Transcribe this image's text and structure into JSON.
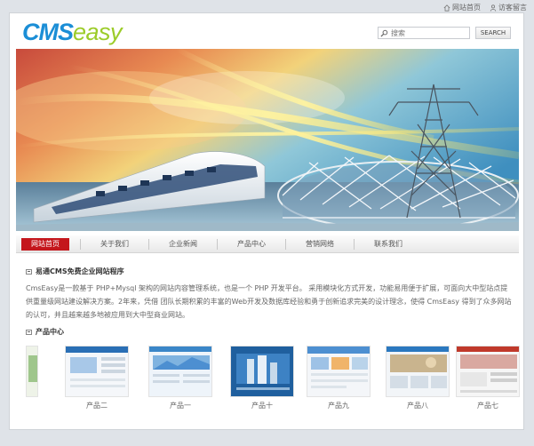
{
  "topbar": {
    "home": "网站首页",
    "guestbook": "访客留言"
  },
  "logo": {
    "part1": "CMS",
    "part2": "easy"
  },
  "search": {
    "placeholder": "搜索",
    "button": "SEARCH"
  },
  "nav": [
    {
      "label": "网站首页",
      "active": true
    },
    {
      "label": "关于我们",
      "active": false
    },
    {
      "label": "企业新闻",
      "active": false
    },
    {
      "label": "产品中心",
      "active": false
    },
    {
      "label": "营销网络",
      "active": false
    },
    {
      "label": "联系我们",
      "active": false
    }
  ],
  "about": {
    "title": "易通CMS免费企业网站程序",
    "text": "CmsEasy是一款基于 PHP+Mysql 架构的网站内容管理系统，也是一个 PHP 开发平台。 采用模块化方式开发，功能易用便于扩展，可面向大中型站点提供重量级网站建设解决方案。2年来，凭借 团队长期积累的丰富的Web开发及数据库经验和勇于创新追求完美的设计理念，使得 CmsEasy 得到了众多网站的认可，并且越来越多地被应用到大中型商业网站。"
  },
  "products": {
    "title": "产品中心",
    "items": [
      {
        "caption": "产品二",
        "accent": "#2a6fb5"
      },
      {
        "caption": "产品一",
        "accent": "#3a86c8"
      },
      {
        "caption": "产品十",
        "accent": "#1f5f9e"
      },
      {
        "caption": "产品九",
        "accent": "#4d8fd1"
      },
      {
        "caption": "产品八",
        "accent": "#2b78bf"
      },
      {
        "caption": "产品七",
        "accent": "#c0392b"
      }
    ]
  },
  "colors": {
    "brand_blue": "#1b8ed6",
    "brand_green": "#9ccc2a",
    "nav_active": "#c4161c"
  }
}
